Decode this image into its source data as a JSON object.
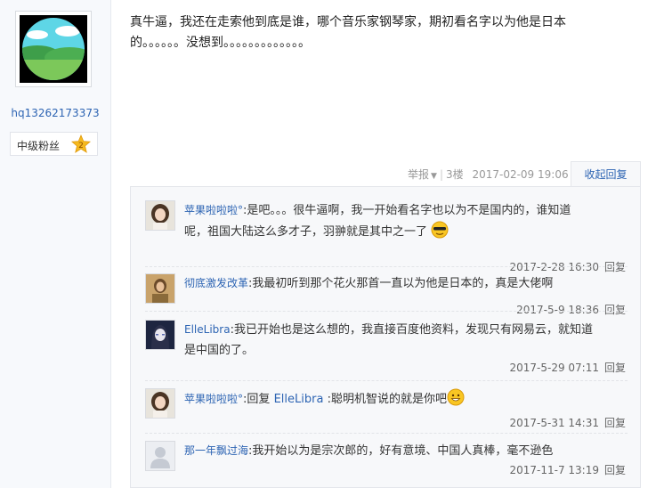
{
  "author": {
    "username": "hq13262173373",
    "level_label": "中级粉丝",
    "level_number": "2"
  },
  "post": {
    "text_line1": "真牛逼，我还在走索他到底是谁，哪个音乐家钢琴家，期初看名字以为他是日本",
    "text_line2": "的。。。。。。没想到。。。。。。。。。。。。。",
    "report_label": "举报",
    "floor": "3楼",
    "timestamp": "2017-02-09 19:06",
    "collapse_reply_label": "收起回复"
  },
  "replies": [
    {
      "name": "苹果啦啦啦°",
      "colon": ":",
      "text_line1": "是吧。。。很牛逼啊，我一开始看名字也以为不是国内的，谁知道",
      "text_line2": "呢，祖国大陆这么多才子，羽翀就是其中之一了",
      "timestamp": "2017-2-28 16:30",
      "reply_label": "回复",
      "avatar": "girl-avatar",
      "emoji": "cool-sunglasses-emoji"
    },
    {
      "name": "彻底激发改革",
      "colon": ":",
      "text_line1": "我最初听到那个花火那首一直以为他是日本的，真是大佬啊",
      "timestamp": "2017-5-9 18:36",
      "reply_label": "回复",
      "avatar": "photo-avatar"
    },
    {
      "name": "ElleLibra",
      "colon": ":",
      "text_line1": "我已开始也是这么想的，我直接百度他资料，发现只有网易云，就知道",
      "text_line2": "是中国的了。",
      "timestamp": "2017-5-29 07:11",
      "reply_label": "回复",
      "avatar": "anime-avatar"
    },
    {
      "name": "苹果啦啦啦°",
      "colon": ":",
      "reply_prefix": "回复",
      "at_name": "ElleLibra",
      "text_line1": ":聪明机智说的就是你吧",
      "timestamp": "2017-5-31 14:31",
      "reply_label": "回复",
      "avatar": "girl-avatar",
      "emoji": "grin-emoji"
    },
    {
      "name": "那一年飘过海",
      "colon": ":",
      "text_line1": "我开始以为是宗次郎的，好有意境、中国人真棒，毫不逊色",
      "timestamp": "2017-11-7 13:19",
      "reply_label": "回复",
      "avatar": "default-user-avatar"
    }
  ],
  "colors": {
    "link_blue": "#2d64b3",
    "panel_bg": "#f7f8fa",
    "left_col_bg": "#f7f9fc",
    "star_gold": "#f5b91e"
  }
}
